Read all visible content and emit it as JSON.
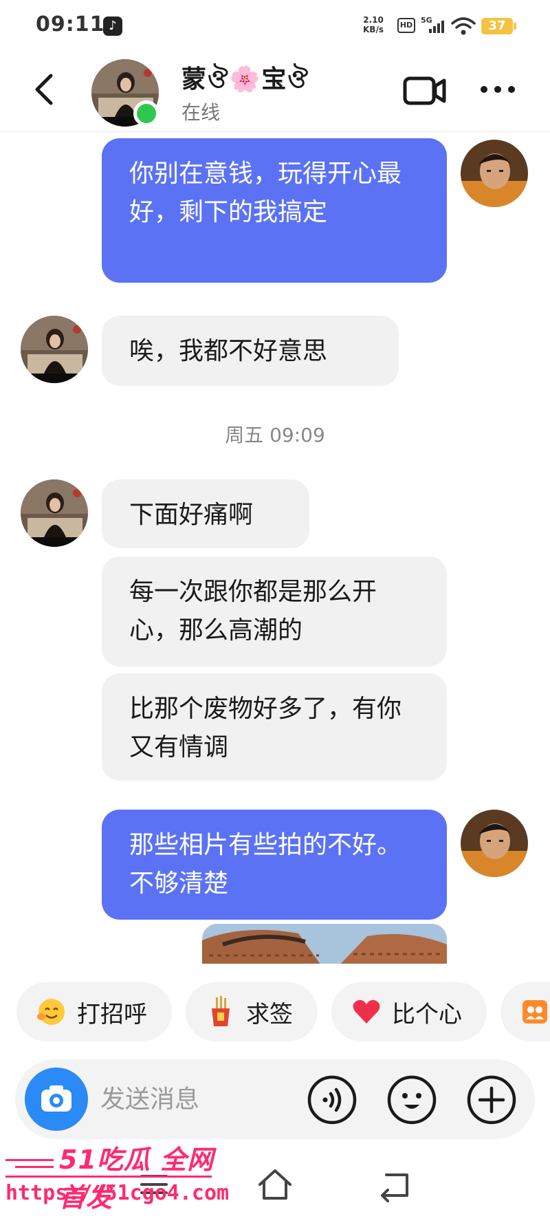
{
  "status_bar": {
    "time": "09:11",
    "net_speed_value": "2.10",
    "net_speed_unit": "KB/s",
    "hd_label": "HD",
    "network_label": "5G",
    "battery": "37"
  },
  "header": {
    "contact_name": "蒙ঔ🌸宝ঔ",
    "contact_status": "在线"
  },
  "messages": [
    {
      "from": "me",
      "text": "你别在意钱，玩得开心最好，剩下的我搞定"
    },
    {
      "from": "them",
      "text": "唉，我都不好意思"
    },
    {
      "type": "time",
      "text": "周五 09:09"
    },
    {
      "from": "them",
      "text": "下面好痛啊"
    },
    {
      "from": "them",
      "text": "每一次跟你都是那么开心，那么高潮的"
    },
    {
      "from": "them",
      "text": "比那个废物好多了，有你又有情调"
    },
    {
      "from": "me",
      "text": "那些相片有些拍的不好。不够清楚"
    }
  ],
  "quick_replies": [
    {
      "label": "打招呼",
      "icon": "smiley-wave-icon"
    },
    {
      "label": "求签",
      "icon": "fortune-stick-icon"
    },
    {
      "label": "比个心",
      "icon": "heart-icon"
    },
    {
      "label": "",
      "icon": "group-photo-icon"
    }
  ],
  "input": {
    "placeholder": "发送消息"
  },
  "watermark": {
    "line1": "51吃瓜 全网首发",
    "line2": "https://51cgo4.com"
  },
  "colors": {
    "my_bubble": "#5b72f5",
    "their_bubble": "#f1f1f2",
    "online": "#2fc84e",
    "camera_button": "#2a8af6",
    "watermark": "#ff2a6f"
  }
}
